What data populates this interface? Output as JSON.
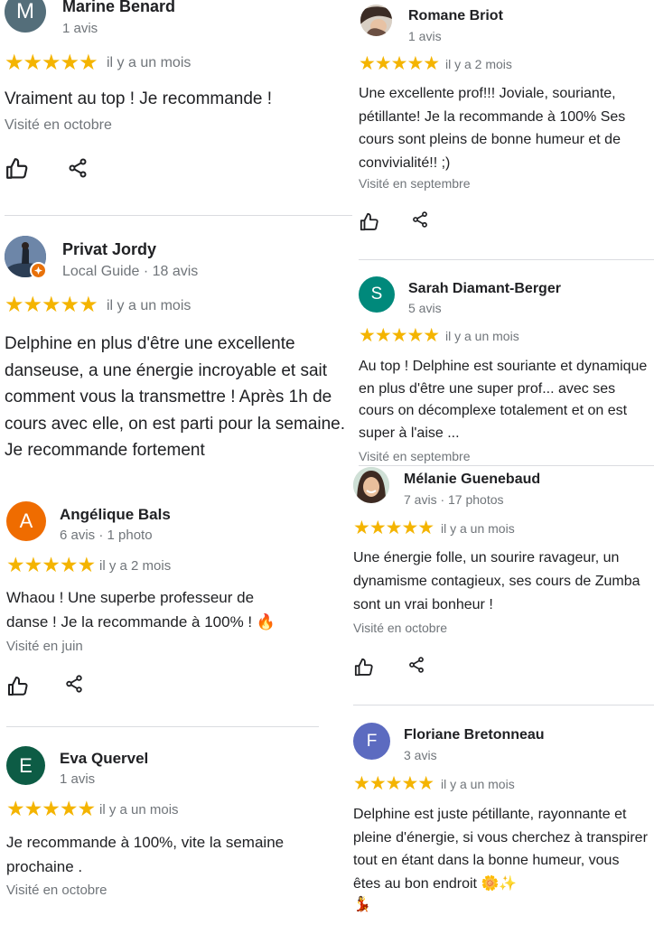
{
  "reviews": {
    "marine": {
      "initial": "M",
      "avatar_color": "#546e7a",
      "name": "Marine Benard",
      "meta": "1 avis",
      "stars": "★★★★★",
      "date": "il y a un mois",
      "text": "Vraiment au top ! Je recommande !",
      "visited": "Visité en octobre"
    },
    "privat": {
      "name": "Privat Jordy",
      "meta": "Local Guide · 18 avis",
      "stars": "★★★★★",
      "date": "il y a un mois",
      "text": "Delphine en plus d'être une excellente danseuse, a une énergie incroyable et sait comment vous la transmettre ! Après 1h de cours avec elle, on est parti pour la semaine. Je recommande fortement"
    },
    "angelique": {
      "initial": "A",
      "avatar_color": "#ef6c00",
      "name": "Angélique Bals",
      "meta": "6 avis · 1 photo",
      "stars": "★★★★★",
      "date": "il y a 2 mois",
      "text": "Whaou ! Une superbe professeur de danse ! Je la recommande à 100% ! 🔥",
      "visited": "Visité en juin"
    },
    "eva": {
      "initial": "E",
      "avatar_color": "#0d5c45",
      "name": "Eva Quervel",
      "meta": "1 avis",
      "stars": "★★★★★",
      "date": "il y a un mois",
      "text": "Je recommande à 100%, vite la semaine prochaine .",
      "visited": "Visité en octobre"
    },
    "romane": {
      "name": "Romane Briot",
      "meta": "1 avis",
      "stars": "★★★★★",
      "date": "il y a 2 mois",
      "text": "Une excellente prof!!! Joviale, souriante, pétillante! Je la recommande à 100% Ses cours sont pleins de bonne humeur et de convivialité!! ;)",
      "visited": "Visité en septembre"
    },
    "sarah": {
      "initial": "S",
      "avatar_color": "#00897b",
      "name": "Sarah Diamant-Berger",
      "meta": "5 avis",
      "stars": "★★★★★",
      "date": "il y a un mois",
      "text": "Au top ! Delphine est souriante et dynamique en plus d'être une super prof... avec ses cours on décomplexe totalement et on est super à l'aise ...",
      "visited": "Visité en septembre"
    },
    "melanie": {
      "name": "Mélanie Guenebaud",
      "meta": "7 avis · 17 photos",
      "stars": "★★★★★",
      "date": "il y a un mois",
      "text": "Une énergie folle, un sourire ravageur, un dynamisme contagieux, ses cours de Zumba sont un vrai bonheur !",
      "visited": "Visité en octobre"
    },
    "floriane": {
      "initial": "F",
      "avatar_color": "#5c6bc0",
      "name": "Floriane Bretonneau",
      "meta": "3 avis",
      "stars": "★★★★★",
      "date": "il y a un mois",
      "text": "Delphine est juste pétillante, rayonnante et pleine d'énergie, si vous cherchez à transpirer tout en étant dans la bonne humeur, vous êtes au bon endroit 🌼✨",
      "text_end": "💃"
    }
  },
  "icons": {
    "like": "thumbs-up-icon",
    "share": "share-icon",
    "local_guide": "local-guide-badge-icon"
  },
  "colors": {
    "stars": "#f4b400",
    "meta": "#70757a"
  }
}
